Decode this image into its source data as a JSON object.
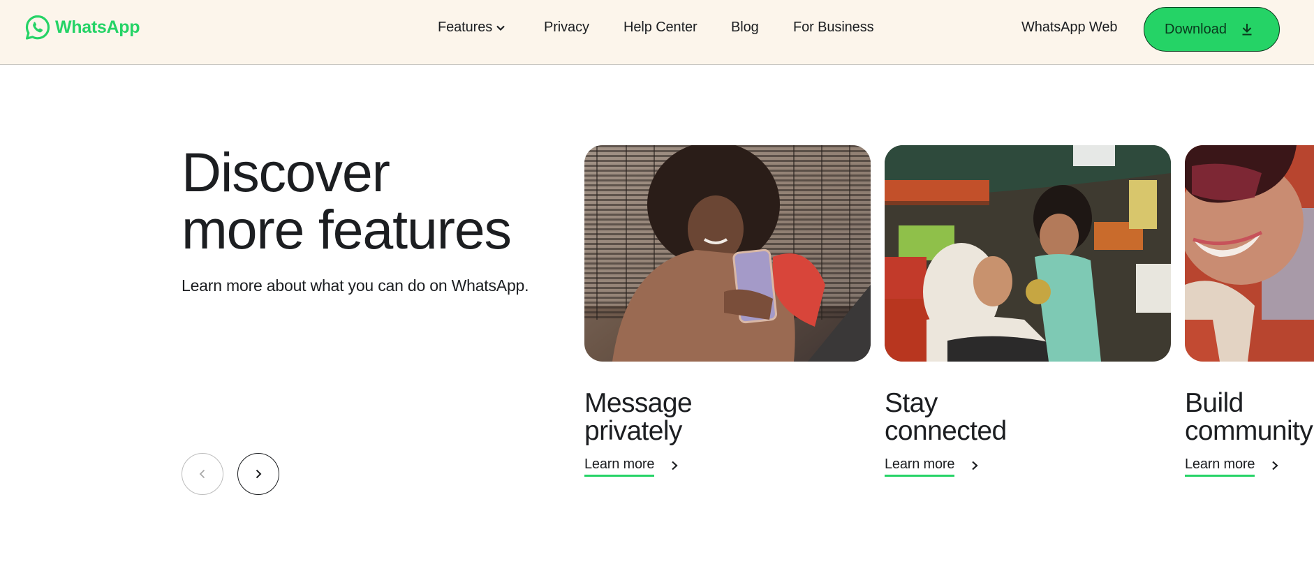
{
  "header": {
    "logo_icon": "whatsapp-logo-icon",
    "logo_text": "WhatsApp",
    "nav": [
      {
        "label": "Features",
        "has_dropdown": true
      },
      {
        "label": "Privacy"
      },
      {
        "label": "Help Center"
      },
      {
        "label": "Blog"
      },
      {
        "label": "For Business"
      }
    ],
    "web_link": "WhatsApp Web",
    "download_label": "Download",
    "download_icon": "download-arrow-icon"
  },
  "hero": {
    "title_line1": "Discover",
    "title_line2": "more features",
    "subtitle": "Learn more about what you can do on WhatsApp."
  },
  "carousel": {
    "prev_icon": "chevron-left-icon",
    "next_icon": "chevron-right-icon",
    "prev_enabled": false,
    "next_enabled": true,
    "cards": [
      {
        "title_line1": "Message",
        "title_line2": "privately",
        "link_label": "Learn more",
        "image": "woman-with-curly-hair-looking-at-phone"
      },
      {
        "title_line1": "Stay",
        "title_line2": "connected",
        "link_label": "Learn more",
        "image": "grandmother-holding-child-at-market"
      },
      {
        "title_line1": "Build",
        "title_line2": "community",
        "link_label": "Learn more",
        "image": "smiling-person-with-sunglasses"
      }
    ]
  },
  "colors": {
    "brand_green": "#25d366",
    "header_bg": "#fcf5eb",
    "text": "#1c1e21",
    "button_text": "#0a3a1e"
  }
}
